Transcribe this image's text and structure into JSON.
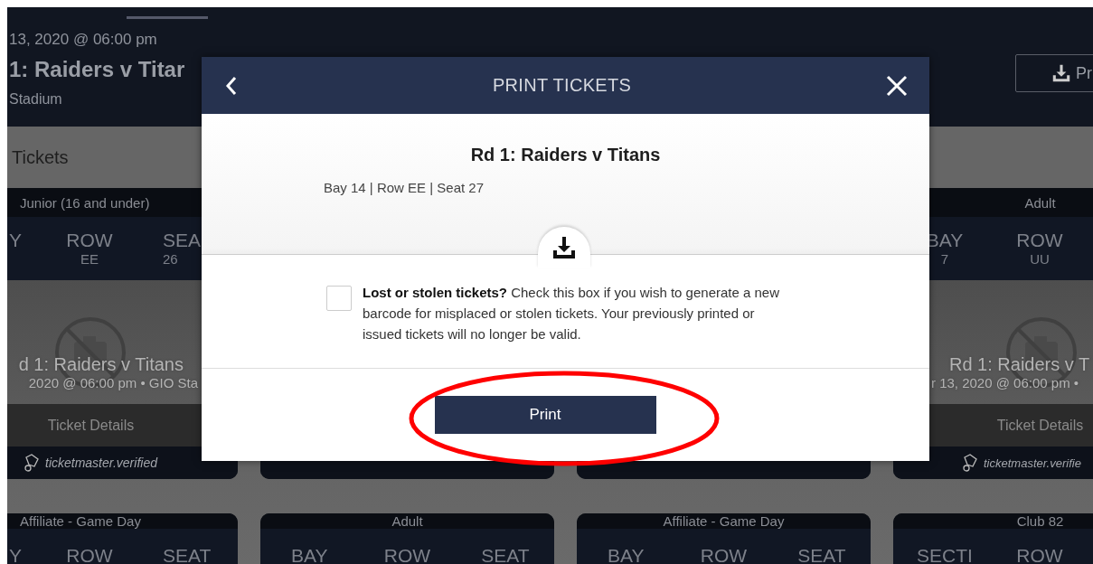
{
  "page_header": {
    "event_date": "13, 2020 @ 06:00 pm",
    "event_title": "1: Raiders v Titar",
    "venue": "Stadium",
    "print_button": "Pr"
  },
  "section_title": "Tickets",
  "ticket_rows": [
    [
      {
        "kind": "cut_left",
        "type": "Junior (16 and under)",
        "seat_fields": [
          {
            "label": "Y"
          },
          {
            "label": "ROW",
            "value": "EE"
          },
          {
            "label": "SEA",
            "value": "26"
          }
        ],
        "image_title": "d 1: Raiders v Titans",
        "image_subtitle": "2020 @ 06:00 pm • GIO Sta",
        "details_button": "Ticket Details",
        "verified": "ticketmaster.verified"
      },
      {
        "kind": "covered"
      },
      {
        "kind": "covered"
      },
      {
        "kind": "cut_right",
        "type": "Adult",
        "seat_fields": [
          {
            "label": "BAY",
            "value": "7"
          },
          {
            "label": "ROW",
            "value": "UU"
          }
        ],
        "image_title": "Rd 1: Raiders v T",
        "image_subtitle": "r 13, 2020 @ 06:00 pm •",
        "details_button": "Ticket Details",
        "verified": "ticketmaster.verifie"
      }
    ],
    [
      {
        "kind": "cut_left",
        "type": "Affiliate - Game Day",
        "seat_fields": [
          {
            "label": "Y"
          },
          {
            "label": "ROW"
          },
          {
            "label": "SEAT"
          }
        ]
      },
      {
        "kind": "full",
        "type": "Adult",
        "seat_fields": [
          {
            "label": "BAY"
          },
          {
            "label": "ROW"
          },
          {
            "label": "SEAT"
          }
        ]
      },
      {
        "kind": "full",
        "type": "Affiliate - Game Day",
        "seat_fields": [
          {
            "label": "BAY"
          },
          {
            "label": "ROW"
          },
          {
            "label": "SEAT"
          }
        ]
      },
      {
        "kind": "cut_right",
        "type": "Club 82",
        "seat_fields": [
          {
            "label": "SECTI"
          },
          {
            "label": "ROW"
          }
        ]
      }
    ]
  ],
  "modal": {
    "title": "PRINT TICKETS",
    "event_title": "Rd 1: Raiders v Titans",
    "seat_info": "Bay 14 | Row EE | Seat 27",
    "lost_tickets": {
      "checked": false,
      "text": "**Lost or stolen tickets?** Check this box if you wish to generate a new barcode for misplaced or stolen tickets. Your previously printed or issued tickets will no longer be valid."
    },
    "print_button": "Print"
  }
}
